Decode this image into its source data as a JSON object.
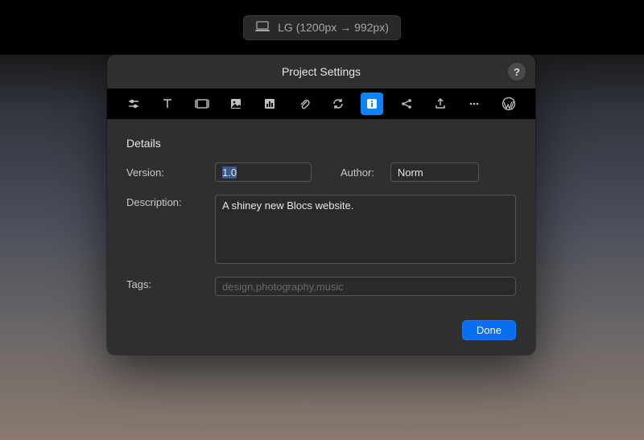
{
  "topbar": {
    "breakpoint_label": "LG (1200px → 992px)"
  },
  "modal": {
    "title": "Project Settings",
    "help_label": "?",
    "section_title": "Details",
    "version_label": "Version:",
    "version_value": "1.0",
    "author_label": "Author:",
    "author_value": "Norm",
    "description_label": "Description:",
    "description_value": "A shiney new Blocs website.",
    "tags_label": "Tags:",
    "tags_placeholder": "design,photography,music",
    "tags_value": "",
    "done_label": "Done"
  },
  "tabs": [
    {
      "name": "sliders-icon",
      "active": false
    },
    {
      "name": "text-icon",
      "active": false
    },
    {
      "name": "frame-icon",
      "active": false
    },
    {
      "name": "image-icon",
      "active": false
    },
    {
      "name": "chart-icon",
      "active": false
    },
    {
      "name": "attachment-icon",
      "active": false
    },
    {
      "name": "refresh-icon",
      "active": false
    },
    {
      "name": "info-icon",
      "active": true
    },
    {
      "name": "share-icon",
      "active": false
    },
    {
      "name": "upload-icon",
      "active": false
    },
    {
      "name": "more-icon",
      "active": false
    },
    {
      "name": "wordpress-icon",
      "active": false
    }
  ]
}
